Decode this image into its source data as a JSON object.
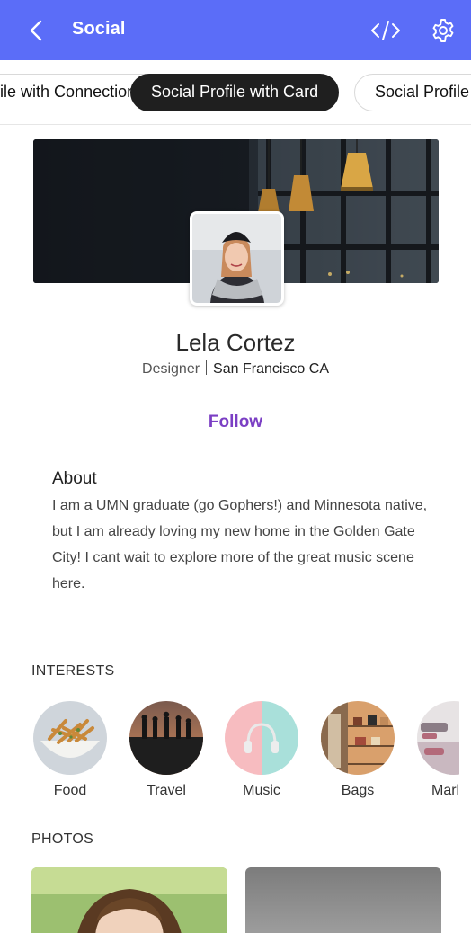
{
  "appbar": {
    "title": "Social",
    "back_icon": "chevron-left-icon",
    "code_icon": "code-icon",
    "settings_icon": "gear-icon",
    "color": "#5b6df8"
  },
  "tabs": [
    {
      "label": "Social Profile with Connections",
      "active": false
    },
    {
      "label": "Social Profile with Card",
      "active": true
    },
    {
      "label": "Social Profile",
      "active": false
    }
  ],
  "profile": {
    "name": "Lela Cortez",
    "role": "Designer",
    "location": "San Francisco CA",
    "follow_label": "Follow"
  },
  "about": {
    "heading": "About",
    "text": "I am a UMN graduate (go Gophers!) and Minnesota native, but I am already loving my new home in the Golden Gate City! I cant wait to explore more of the great music scene here."
  },
  "interests": {
    "heading": "INTERESTS",
    "items": [
      {
        "label": "Food"
      },
      {
        "label": "Travel"
      },
      {
        "label": "Music"
      },
      {
        "label": "Bags"
      },
      {
        "label": "Marl"
      }
    ]
  },
  "photos": {
    "heading": "PHOTOS"
  }
}
